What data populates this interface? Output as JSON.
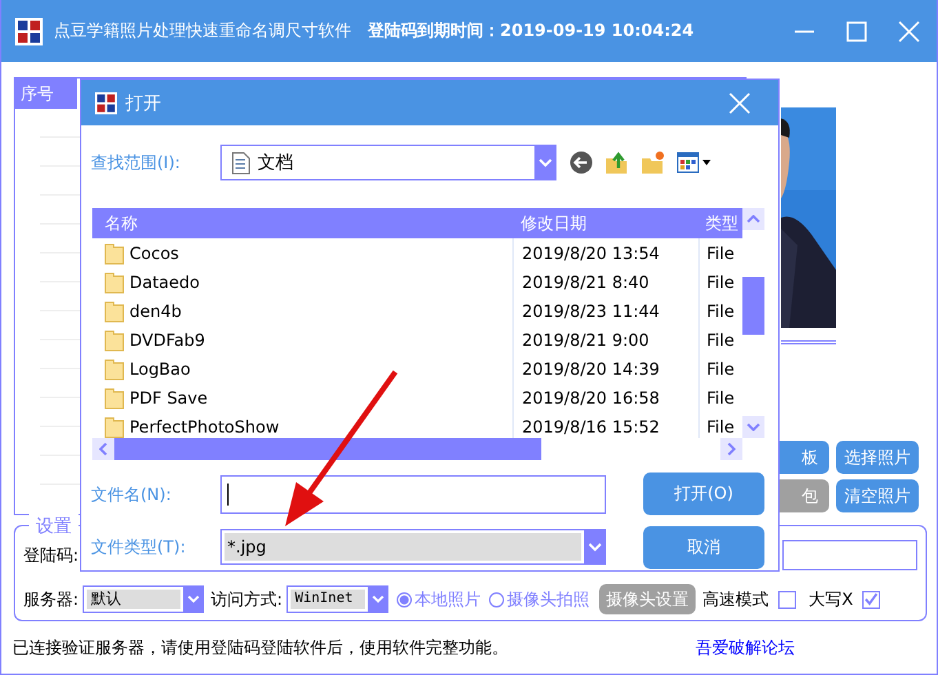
{
  "window": {
    "title": "点豆学籍照片处理快速重命名调尺寸软件",
    "expiry": "登陆码到期时间：2019-09-19 10:04:24"
  },
  "table": {
    "columns": [
      "序号"
    ]
  },
  "buttons": [
    {
      "label": "板",
      "kind": "primary"
    },
    {
      "label": "选择照片",
      "kind": "primary"
    },
    {
      "label": "包",
      "kind": "secondary"
    },
    {
      "label": "清空照片",
      "kind": "primary"
    }
  ],
  "settings": {
    "title": "设置",
    "login_label": "登陆码:",
    "server_label": "服务器:",
    "server": "默认",
    "access_label": "访问方式:",
    "access": "WinInet",
    "sources": [
      {
        "label": "本地照片",
        "selected": true
      },
      {
        "label": "摄像头拍照",
        "selected": false
      }
    ],
    "camera_button": "摄像头设置",
    "options": [
      {
        "label": "高速模式",
        "checked": false
      },
      {
        "label": "大写X",
        "checked": true
      }
    ]
  },
  "status_bar": {
    "message": "已连接验证服务器，请使用登陆码登陆软件后，使用软件完整功能。",
    "link": "吾爱破解论坛"
  },
  "dialog": {
    "title": "打开",
    "look_in_label": "查找范围(I):",
    "look_in": "文档",
    "columns": [
      "名称",
      "修改日期",
      "类型"
    ],
    "files": [
      {
        "name": "Cocos",
        "modified": "2019/8/20 13:54",
        "type": "File"
      },
      {
        "name": "Dataedo",
        "modified": "2019/8/21 8:40",
        "type": "File"
      },
      {
        "name": "den4b",
        "modified": "2019/8/23 11:44",
        "type": "File"
      },
      {
        "name": "DVDFab9",
        "modified": "2019/8/21 9:00",
        "type": "File"
      },
      {
        "name": "LogBao",
        "modified": "2019/8/20 14:39",
        "type": "File"
      },
      {
        "name": "PDF Save",
        "modified": "2019/8/20 16:58",
        "type": "File"
      },
      {
        "name": "PerfectPhotoShow",
        "modified": "2019/8/16 15:52",
        "type": "File"
      }
    ],
    "filename_label": "文件名(N):",
    "filetype_label": "文件类型(T):",
    "filetype": "*.jpg",
    "buttons": [
      "打开(O)",
      "取消"
    ]
  }
}
